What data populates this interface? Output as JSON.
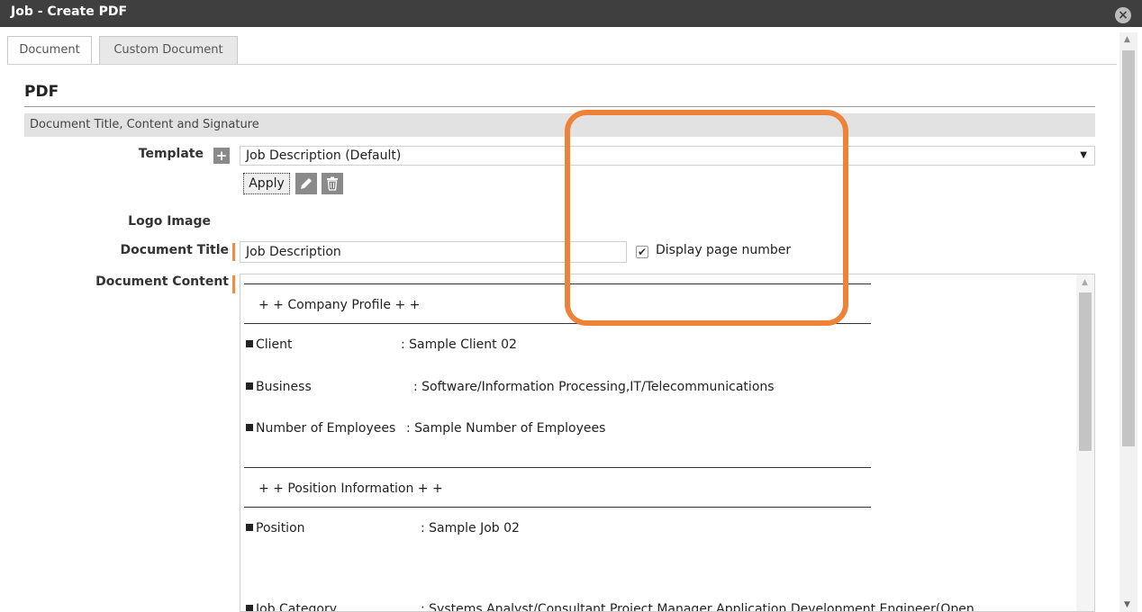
{
  "window": {
    "title": "Job - Create PDF",
    "close_glyph": "×"
  },
  "tabs": [
    {
      "label": "Document",
      "active": true
    },
    {
      "label": "Custom Document",
      "active": false
    }
  ],
  "heading": "PDF",
  "section": {
    "title": "Document Title, Content and Signature"
  },
  "form": {
    "template_label": "Template",
    "add_glyph": "+",
    "template_value": "Job Description (Default)",
    "dropdown_caret": "▼",
    "apply_label": "Apply",
    "logo_label": "Logo Image",
    "doc_title_label": "Document Title",
    "doc_title_value": "Job Description",
    "page_number_label": "Display page number",
    "page_number_checked": true,
    "check_glyph": "✔",
    "doc_content_label": "Document Content"
  },
  "content": {
    "company_header": "+ +   Company Profile   + +",
    "position_header": "+ +   Position Information   + +",
    "fields": [
      {
        "label": "Client",
        "value": ": Sample Client 02"
      },
      {
        "label": "Business",
        "value": ": Software/Information Processing,IT/Telecommunications"
      },
      {
        "label": "Number of Employees",
        "value": ": Sample Number of Employees"
      },
      {
        "label": "Position",
        "value": ": Sample Job 02"
      },
      {
        "label": "Job Category",
        "value": ": Systems Analyst/Consultant,Project Manager,Application Development Engineer(Open"
      }
    ]
  },
  "colors": {
    "titlebar": "#3f3f3f",
    "required_marker": "#f08c3c",
    "highlight": "#ee8236"
  },
  "icons": [
    "close-icon",
    "plus-icon",
    "pencil-icon",
    "trash-icon",
    "checkmark-icon",
    "dropdown-caret-icon",
    "scroll-up-icon",
    "scroll-down-icon"
  ]
}
